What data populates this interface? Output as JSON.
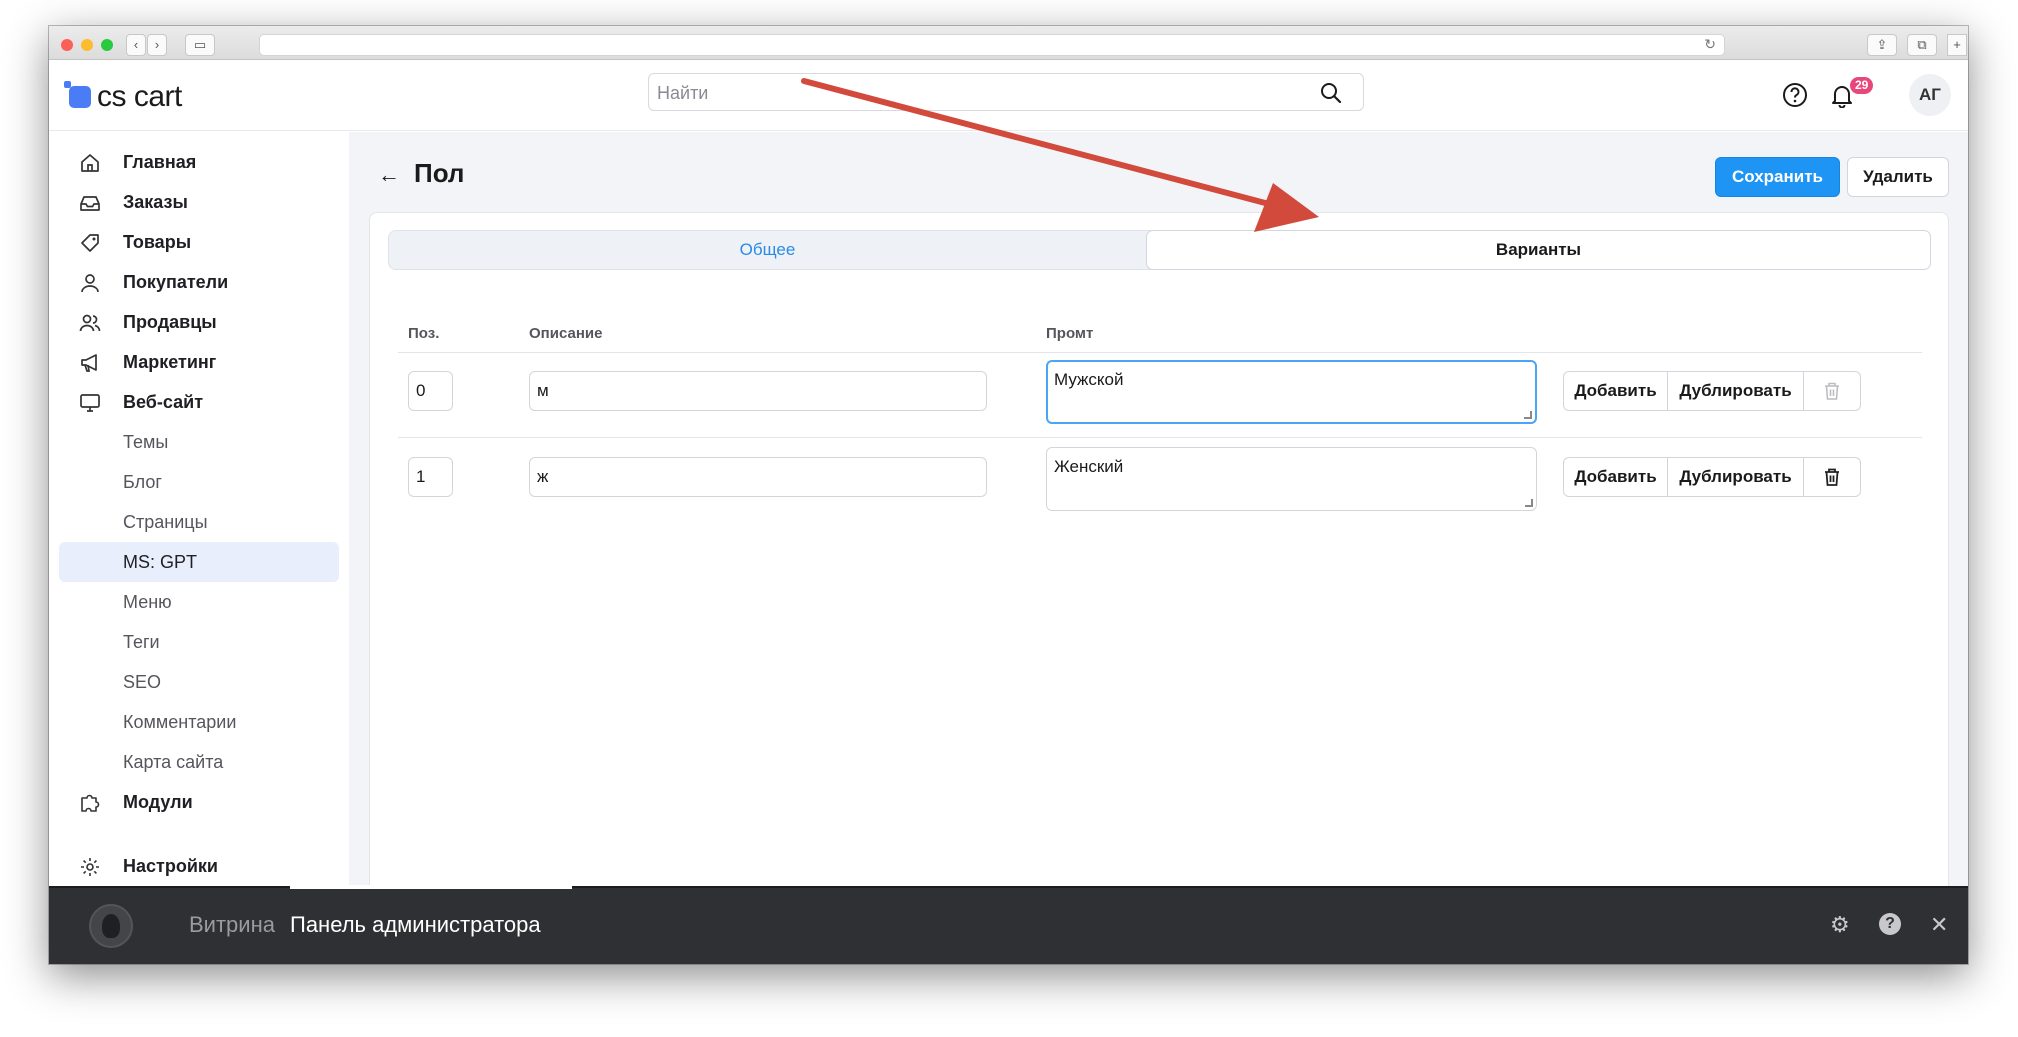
{
  "header": {
    "logo_text": "cs cart",
    "search_placeholder": "Найти",
    "notifications_count": "29",
    "user_initials": "АГ"
  },
  "sidebar": {
    "items": [
      {
        "label": "Главная",
        "icon": "home-icon"
      },
      {
        "label": "Заказы",
        "icon": "inbox-icon"
      },
      {
        "label": "Товары",
        "icon": "tag-icon"
      },
      {
        "label": "Покупатели",
        "icon": "user-icon"
      },
      {
        "label": "Продавцы",
        "icon": "users-icon"
      },
      {
        "label": "Маркетинг",
        "icon": "megaphone-icon"
      },
      {
        "label": "Веб-сайт",
        "icon": "monitor-icon"
      },
      {
        "label": "Темы"
      },
      {
        "label": "Блог"
      },
      {
        "label": "Страницы"
      },
      {
        "label": "MS: GPT",
        "active": true
      },
      {
        "label": "Меню"
      },
      {
        "label": "Теги"
      },
      {
        "label": "SEO"
      },
      {
        "label": "Комментарии"
      },
      {
        "label": "Карта сайта"
      },
      {
        "label": "Модули",
        "icon": "puzzle-icon"
      },
      {
        "label": "Настройки",
        "icon": "gear-icon"
      }
    ]
  },
  "page": {
    "title": "Пол",
    "save_label": "Сохранить",
    "delete_label": "Удалить",
    "tabs": [
      "Общее",
      "Варианты"
    ],
    "active_tab": "Варианты"
  },
  "table": {
    "columns": [
      "Поз.",
      "Описание",
      "Промт"
    ],
    "rows": [
      {
        "position": "0",
        "description": "м",
        "prompt": "Мужской"
      },
      {
        "position": "1",
        "description": "ж",
        "prompt": "Женский"
      }
    ],
    "add_label": "Добавить",
    "duplicate_label": "Дублировать"
  },
  "bottombar": {
    "storefront_label": "Витрина",
    "admin_label": "Панель администратора"
  },
  "colors": {
    "accent": "#1e95f5",
    "tab_link": "#2b8be6",
    "badge": "#e8477b",
    "annotation_arrow": "#d24a3c"
  }
}
